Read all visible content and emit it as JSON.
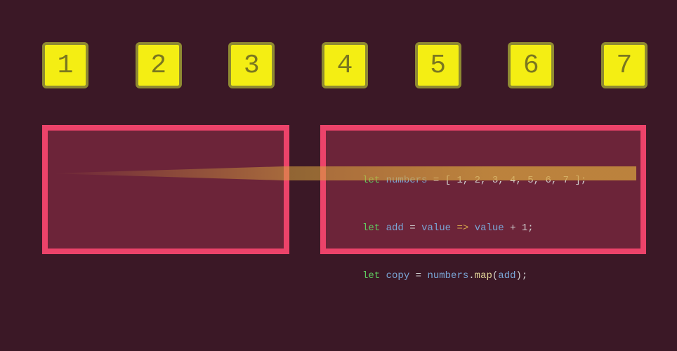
{
  "boxes": [
    "1",
    "2",
    "3",
    "4",
    "5",
    "6",
    "7"
  ],
  "code": {
    "line1": {
      "kw": "let",
      "id": "numbers",
      "rest": " = [ 1, 2, 3, 4, 5, 6, 7 ];"
    },
    "line2": {
      "kw": "let",
      "id": "add",
      "eq": " = ",
      "v1": "value",
      "arr": " => ",
      "v2": "value",
      "tail": " + 1;"
    },
    "line3": {
      "kw": "let",
      "id": "copy",
      "eq": " = ",
      "obj": "numbers",
      "dot": ".",
      "fn": "map",
      "open": "(",
      "arg": "add",
      "close": ");"
    }
  }
}
